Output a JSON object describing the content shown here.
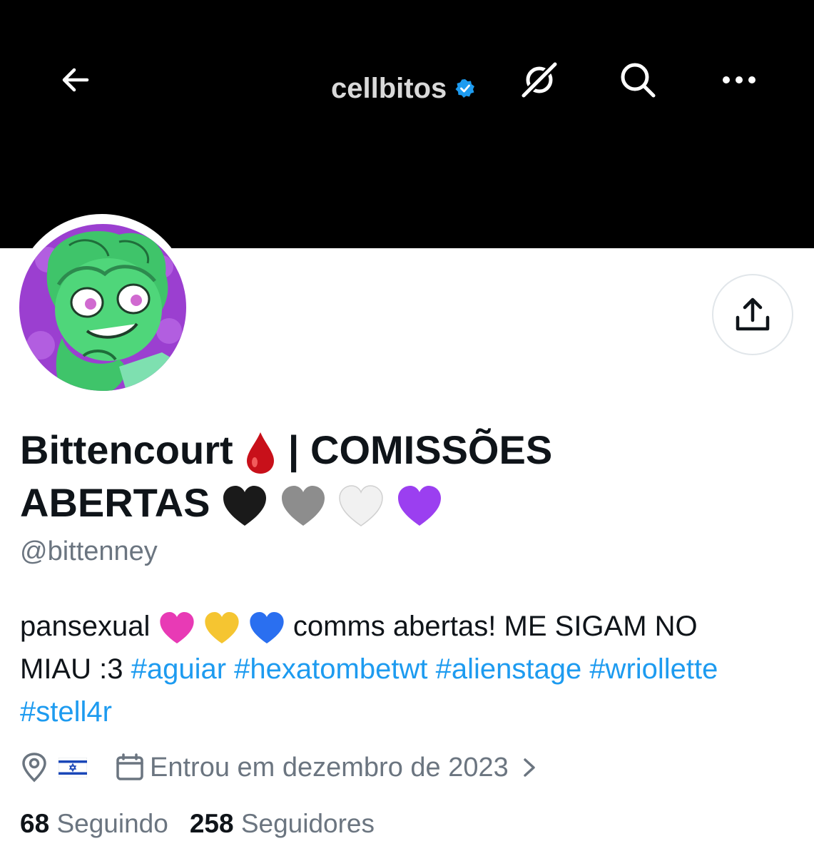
{
  "header": {
    "username": "cellbitos",
    "back_icon": "arrow-left-icon",
    "verified_icon": "verified-badge-icon",
    "actions": [
      "slash-circle-icon",
      "search-icon",
      "more-icon"
    ]
  },
  "profile": {
    "display_name": "Bittencourt",
    "name_separator": "| COMISSÕES",
    "name_line2": "ABERTAS",
    "handle": "@bittenney",
    "bio": {
      "text1": "pansexual",
      "text2": "comms abertas! ME SIGAM NO MIAU :3",
      "hashtags": [
        "#aguiar",
        "#hexatombetwt",
        "#alienstage",
        "#wriollette",
        "#stell4r"
      ]
    },
    "location_flag": "israel-flag-icon",
    "joined": "Entrou em dezembro de 2023",
    "following_count": "68",
    "following_label": "Seguindo",
    "followers_count": "258",
    "followers_label": "Seguidores"
  },
  "colors": {
    "accent": "#1d9bf0",
    "secondary_text": "#6b7580",
    "banner": "#000000",
    "avatar_bg": "#9b3fd0",
    "avatar_character": "#4fd67a"
  }
}
